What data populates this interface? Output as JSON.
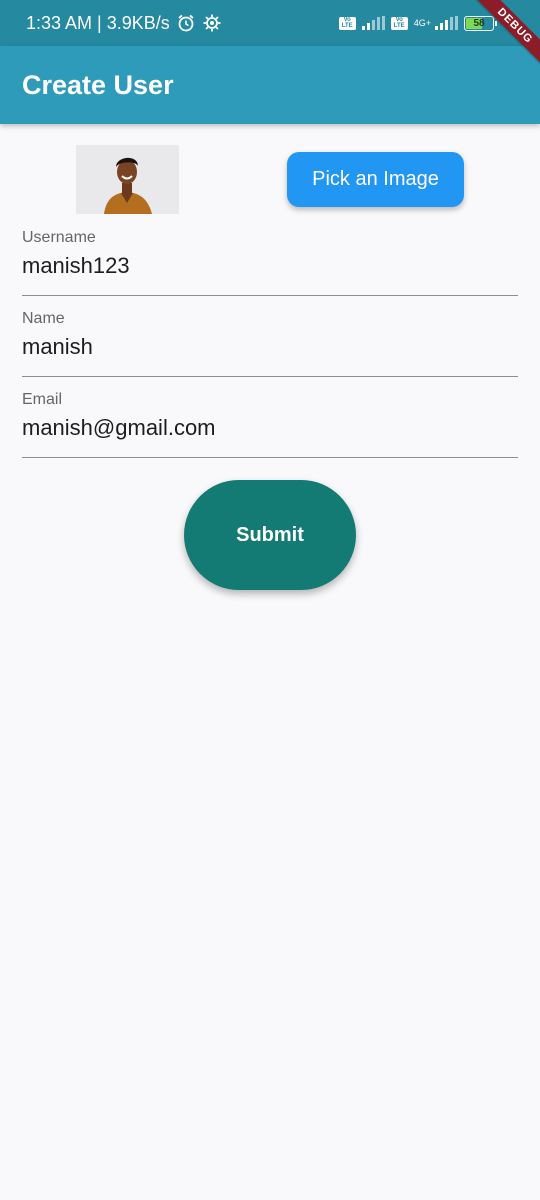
{
  "status_bar": {
    "time_speed": "1:33 AM | 3.9KB/s",
    "net_type": "4G+",
    "battery": "58",
    "volte1": "Vo LTE",
    "volte2": "Vo LTE"
  },
  "debug_banner": "DEBUG",
  "app_bar": {
    "title": "Create User"
  },
  "image_picker": {
    "button_label": "Pick an Image"
  },
  "form": {
    "username": {
      "label": "Username",
      "value": "manish123"
    },
    "name": {
      "label": "Name",
      "value": "manish"
    },
    "email": {
      "label": "Email",
      "value": "manish@gmail.com"
    }
  },
  "submit": {
    "label": "Submit"
  },
  "colors": {
    "status_bar": "#25899f",
    "app_bar": "#2e9bbb",
    "pick_button": "#2196f3",
    "submit_button": "#137a74",
    "battery_fill": "#7ed957",
    "debug_ribbon": "#8c1d28"
  },
  "icons": [
    "alarm-icon",
    "settings-gear-icon",
    "volte-icon",
    "signal-icon",
    "battery-icon"
  ]
}
